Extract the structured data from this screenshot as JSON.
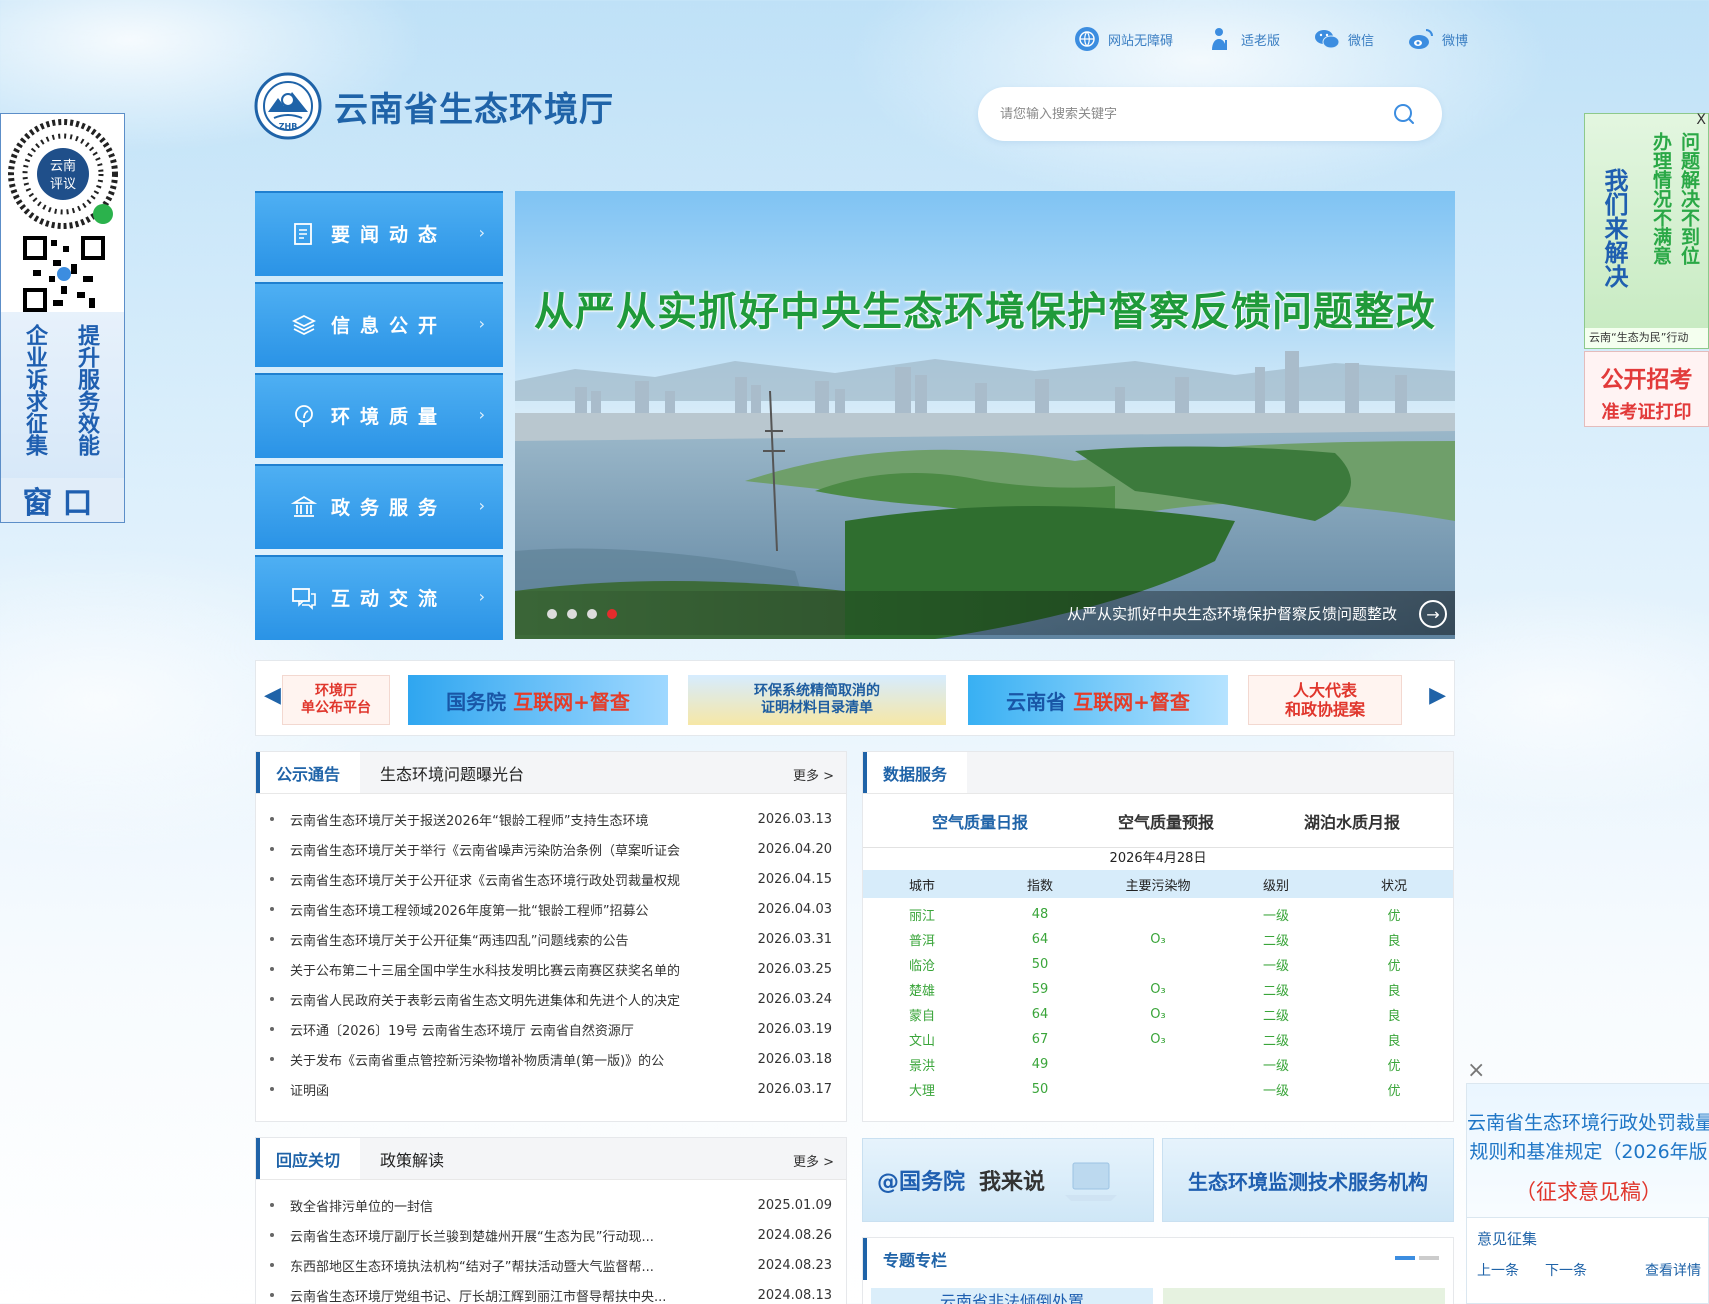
{
  "toplinks": [
    {
      "label": "网站无障碍",
      "icon": "accessibility-icon"
    },
    {
      "label": "适老版",
      "icon": "elderly-icon"
    },
    {
      "label": "微信",
      "icon": "wechat-icon"
    },
    {
      "label": "微博",
      "icon": "weibo-icon"
    }
  ],
  "header": {
    "title": "云南省生态环境厅",
    "emblem_text": "ZHB",
    "search_placeholder": "请您输入搜索关键字"
  },
  "nav": [
    {
      "label": "要闻动态",
      "icon": "document-icon"
    },
    {
      "label": "信息公开",
      "icon": "layers-icon"
    },
    {
      "label": "环境质量",
      "icon": "leaf-pin-icon"
    },
    {
      "label": "政务服务",
      "icon": "government-building-icon"
    },
    {
      "label": "互动交流",
      "icon": "chat-icon"
    }
  ],
  "banner": {
    "headline": "从严从实抓好中央生态环境保护督察反馈问题整改",
    "caption": "从严从实抓好中央生态环境保护督察反馈问题整改",
    "slide_count": 4,
    "active_slide": 4
  },
  "strip": {
    "s1": [
      "环境厅",
      "单公布平台"
    ],
    "s2": {
      "a": "国务院",
      "b": "互联网+督查"
    },
    "s3": [
      "环保系统精简取消的",
      "证明材料目录清单"
    ],
    "s4": {
      "a": "云南省",
      "b": "互联网+督查"
    },
    "s5": [
      "人大代表",
      "和政协提案"
    ]
  },
  "notices": {
    "tabs": [
      "公示通告",
      "生态环境问题曝光台"
    ],
    "more": "更多 >",
    "items": [
      {
        "title": "云南省生态环境厅关于报送2026年“银龄工程师”支持生态环境",
        "date": "2026.03.13"
      },
      {
        "title": "云南省生态环境厅关于举行《云南省噪声污染防治条例（草案听证会",
        "date": "2026.04.20"
      },
      {
        "title": "云南省生态环境厅关于公开征求《云南省生态环境行政处罚裁量权规",
        "date": "2026.04.15"
      },
      {
        "title": "云南省生态环境工程领域2026年度第一批“银龄工程师”招募公",
        "date": "2026.04.03"
      },
      {
        "title": "云南省生态环境厅关于公开征集“两违四乱”问题线索的公告",
        "date": "2026.03.31"
      },
      {
        "title": "关于公布第二十三届全国中学生水科技发明比赛云南赛区获奖名单的",
        "date": "2026.03.25"
      },
      {
        "title": "云南省人民政府关于表彰云南省生态文明先进集体和先进个人的决定",
        "date": "2026.03.24"
      },
      {
        "title": "云环通〔2026〕19号 云南省生态环境厅 云南省自然资源厅",
        "date": "2026.03.19"
      },
      {
        "title": "关于发布《云南省重点管控新污染物增补物质清单(第一版)》的公",
        "date": "2026.03.18"
      },
      {
        "title": "证明函",
        "date": "2026.03.17"
      }
    ]
  },
  "replies": {
    "tabs": [
      "回应关切",
      "政策解读"
    ],
    "more": "更多 >",
    "items": [
      {
        "title": "致全省排污单位的一封信",
        "date": "2025.01.09"
      },
      {
        "title": "云南省生态环境厅副厅长兰骏到楚雄州开展“生态为民”行动现...",
        "date": "2024.08.26"
      },
      {
        "title": "东西部地区生态环境执法机构“结对子”帮扶活动暨大气监督帮...",
        "date": "2024.08.23"
      },
      {
        "title": "云南省生态环境厅党组书记、厅长胡江辉到丽江市督导帮扶中央...",
        "date": "2024.08.13"
      }
    ]
  },
  "data_service": {
    "tab": "数据服务",
    "subtabs": [
      "空气质量日报",
      "空气质量预报",
      "湖泊水质月报"
    ],
    "date": "2026年4月28日",
    "headers": [
      "城市",
      "指数",
      "主要污染物",
      "级别",
      "状况"
    ],
    "rows": [
      [
        "丽江",
        "48",
        "",
        "一级",
        "优"
      ],
      [
        "普洱",
        "64",
        "O₃",
        "二级",
        "良"
      ],
      [
        "临沧",
        "50",
        "",
        "一级",
        "优"
      ],
      [
        "楚雄",
        "59",
        "O₃",
        "二级",
        "良"
      ],
      [
        "蒙自",
        "64",
        "O₃",
        "二级",
        "良"
      ],
      [
        "文山",
        "67",
        "O₃",
        "二级",
        "良"
      ],
      [
        "景洪",
        "49",
        "",
        "一级",
        "优"
      ],
      [
        "大理",
        "50",
        "",
        "一级",
        "优"
      ]
    ]
  },
  "promos": {
    "p1a": "@国务院",
    "p1b": "我来说",
    "p2": "生态环境监测技术服务机构"
  },
  "special": {
    "tab": "专题专栏",
    "item1": "云南省非法倾倒处置"
  },
  "float_left": {
    "badge": [
      "云南",
      "评议"
    ],
    "col1": "企业诉求征集",
    "col2": "提升服务效能",
    "window": "窗口"
  },
  "float_right": {
    "close": "X",
    "col_a": "问题解决不到位",
    "col_b": "办理情况不满意",
    "col_c": "我们来解决",
    "footer": "云南“生态为民”行动"
  },
  "float_right2": {
    "line1": "公开招考",
    "line2": "准考证打印"
  },
  "float_br": {
    "close": "×",
    "line1": "云南省生态环境行政处罚裁量",
    "line2": "规则和基准规定（2026年版",
    "line3": "（征求意见稿）",
    "label": "意见征集",
    "prev": "上一条",
    "next": "下一条",
    "detail": "查看详情"
  },
  "colors": {
    "brand": "#1f63a8",
    "nav": "#2a93e6",
    "good": "#3aa53a",
    "alert": "#e0362c"
  }
}
